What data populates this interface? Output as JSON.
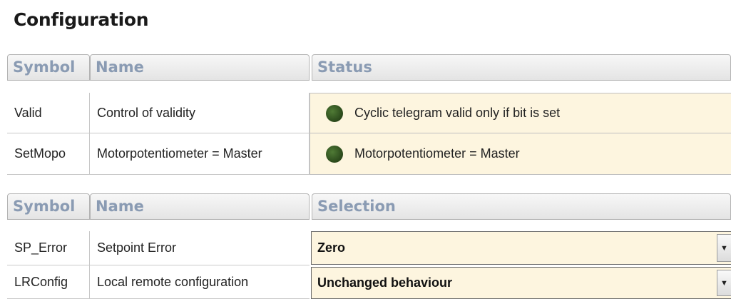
{
  "title": "Configuration",
  "status_table": {
    "headers": {
      "symbol": "Symbol",
      "name": "Name",
      "status": "Status"
    },
    "rows": [
      {
        "symbol": "Valid",
        "name": "Control of validity",
        "status": "Cyclic telegram valid only if bit is set",
        "indicator_color": "#2f4f1e"
      },
      {
        "symbol": "SetMopo",
        "name": "Motorpotentiometer = Master",
        "status": "Motorpotentiometer = Master",
        "indicator_color": "#2f4f1e"
      }
    ]
  },
  "selection_table": {
    "headers": {
      "symbol": "Symbol",
      "name": "Name",
      "selection": "Selection"
    },
    "rows": [
      {
        "symbol": "SP_Error",
        "name": "Setpoint Error",
        "selection": "Zero"
      },
      {
        "symbol": "LRConfig",
        "name": "Local remote configuration",
        "selection": "Unchanged behaviour"
      }
    ]
  },
  "icons": {
    "indicator": "status-led-icon",
    "dropdown": "chevron-down-icon"
  },
  "colors": {
    "header_text": "#8a9bb3",
    "value_background": "#fdf5df",
    "led": "#2f4f1e"
  }
}
